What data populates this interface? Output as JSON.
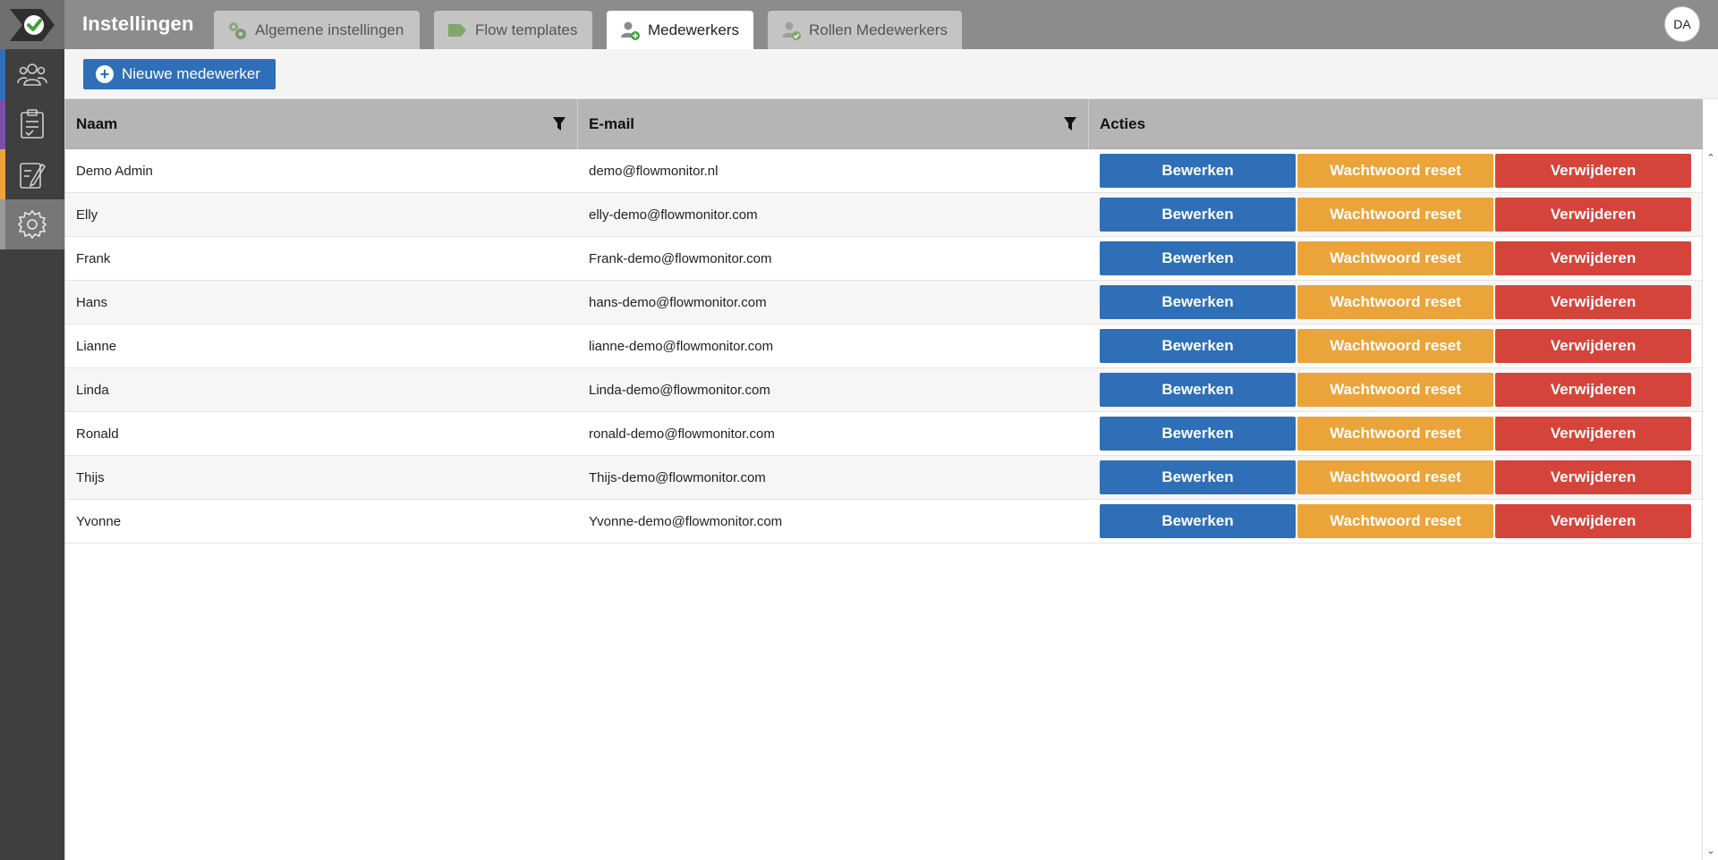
{
  "app": {
    "title": "Instellingen",
    "user_initials": "DA"
  },
  "colors": {
    "primary": "#2e6fb7",
    "warning": "#eba43a",
    "danger": "#d5443a"
  },
  "sidebar": {
    "items": [
      {
        "name": "people-icon",
        "stripe": "#2e6fb7"
      },
      {
        "name": "clipboard-icon",
        "stripe": "#7b4fa8"
      },
      {
        "name": "form-edit-icon",
        "stripe": "#eba43a"
      },
      {
        "name": "gear-icon",
        "stripe": "#9a9a9a",
        "active": true
      }
    ]
  },
  "tabs": [
    {
      "label": "Algemene instellingen",
      "icon": "gears-icon"
    },
    {
      "label": "Flow templates",
      "icon": "flow-icon"
    },
    {
      "label": "Medewerkers",
      "icon": "user-add-icon",
      "active": true
    },
    {
      "label": "Rollen Medewerkers",
      "icon": "user-check-icon"
    }
  ],
  "toolbar": {
    "new_label": "Nieuwe medewerker"
  },
  "table": {
    "columns": [
      "Naam",
      "E-mail",
      "Acties"
    ],
    "action_labels": {
      "edit": "Bewerken",
      "reset": "Wachtwoord reset",
      "delete": "Verwijderen"
    },
    "rows": [
      {
        "name": "Demo Admin",
        "email": "demo@flowmonitor.nl"
      },
      {
        "name": "Elly",
        "email": "elly-demo@flowmonitor.com"
      },
      {
        "name": "Frank",
        "email": "Frank-demo@flowmonitor.com"
      },
      {
        "name": "Hans",
        "email": "hans-demo@flowmonitor.com"
      },
      {
        "name": "Lianne",
        "email": "lianne-demo@flowmonitor.com"
      },
      {
        "name": "Linda",
        "email": "Linda-demo@flowmonitor.com"
      },
      {
        "name": "Ronald",
        "email": "ronald-demo@flowmonitor.com"
      },
      {
        "name": "Thijs",
        "email": "Thijs-demo@flowmonitor.com"
      },
      {
        "name": "Yvonne",
        "email": "Yvonne-demo@flowmonitor.com"
      }
    ]
  }
}
